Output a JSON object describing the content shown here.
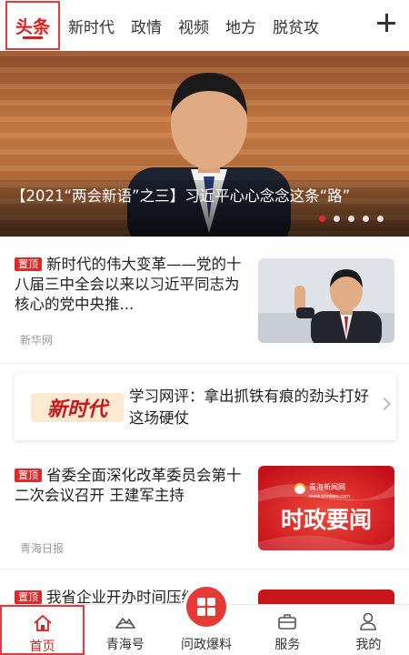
{
  "tabs": [
    "头条",
    "新时代",
    "政情",
    "视频",
    "地方",
    "脱贫攻"
  ],
  "hero": {
    "caption": "【2021“两会新语”之三】习近平心心念念这条“路”",
    "slides": 5,
    "active_slide": 1
  },
  "news": [
    {
      "badge": "置顶",
      "title": "新时代的伟大变革——党的十八届三中全会以来以习近平同志为核心的党中央推...",
      "source": "新华网"
    },
    {
      "logo_text": "新时代",
      "title": "学习网评：拿出抓铁有痕的劲头打好这场硬仗"
    },
    {
      "badge": "置顶",
      "title": "省委全面深化改革委员会第十二次会议召开 王建军主持",
      "source": "青海日报",
      "thumb_brand": "青海新闻网",
      "thumb_site": "www.qhnews.com",
      "thumb_text": "时政要闻"
    },
    {
      "badge": "置顶",
      "title": "我省企业开办时间压缩"
    }
  ],
  "bottom_nav": [
    {
      "label": "首页",
      "icon": "home-icon",
      "active": true
    },
    {
      "label": "青海号",
      "icon": "mountain-icon"
    },
    {
      "label": "问政爆料",
      "icon": "grid-icon"
    },
    {
      "label": "服务",
      "icon": "briefcase-icon"
    },
    {
      "label": "我的",
      "icon": "user-icon"
    }
  ],
  "colors": {
    "accent": "#d71f1f"
  }
}
